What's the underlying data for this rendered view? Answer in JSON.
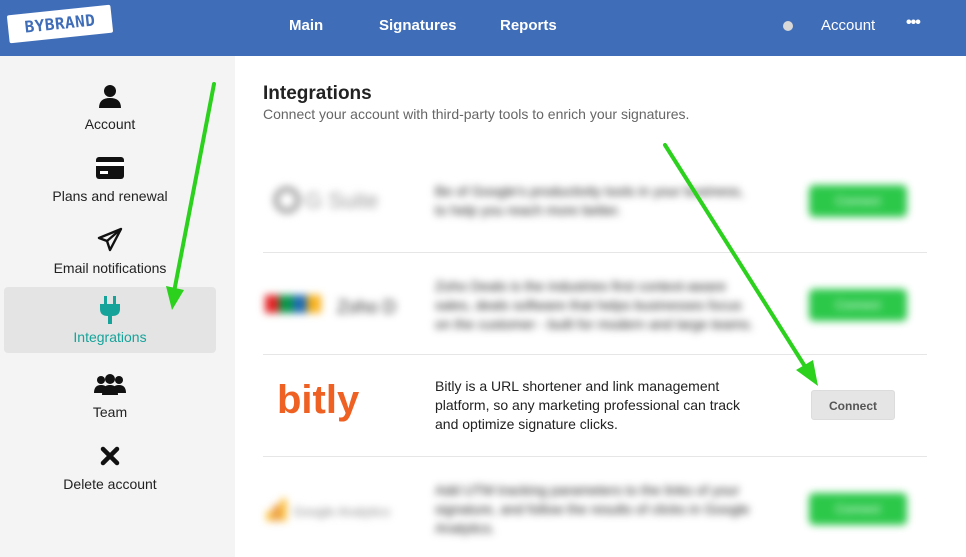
{
  "header": {
    "logo_text": "BYBRAND",
    "nav": [
      {
        "label": "Main"
      },
      {
        "label": "Signatures"
      },
      {
        "label": "Reports"
      }
    ],
    "account_label": "Account",
    "more_label": "•••",
    "brand_color": "#3f6db8"
  },
  "sidebar": {
    "items": [
      {
        "label": "Account",
        "icon": "user-icon"
      },
      {
        "label": "Plans and renewal",
        "icon": "credit-card-icon"
      },
      {
        "label": "Email notifications",
        "icon": "paper-plane-icon"
      },
      {
        "label": "Integrations",
        "icon": "plug-icon",
        "active": true
      },
      {
        "label": "Team",
        "icon": "users-icon"
      },
      {
        "label": "Delete account",
        "icon": "close-icon"
      }
    ],
    "active_color": "#16a39a"
  },
  "main": {
    "title": "Integrations",
    "subtitle": "Connect your account with third-party tools to enrich your signatures.",
    "integrations": [
      {
        "name": "G Suite",
        "description": "Be of Google's productivity tools in your business, to help you reach more better.",
        "button": "Connect",
        "blurred": true
      },
      {
        "name": "Zoho Deals",
        "description": "Zoho Deals is the industries first context-aware sales, deals software that helps businesses focus on the customer - built for modern and large teams.",
        "button": "Connect",
        "blurred": true
      },
      {
        "name": "bitly",
        "description": "Bitly is a URL shortener and link management platform, so any marketing professional can track and optimize signature clicks.",
        "button": "Connect",
        "blurred": false
      },
      {
        "name": "Google Analytics",
        "description": "Add UTM tracking parameters to the links of your signature, and follow the results of clicks in Google Analytics.",
        "button": "Connect",
        "blurred": true
      }
    ],
    "bitly_color": "#ee6123",
    "connect_green": "#2cc84a"
  },
  "annotations": {
    "arrow_color": "#2bd11c"
  }
}
